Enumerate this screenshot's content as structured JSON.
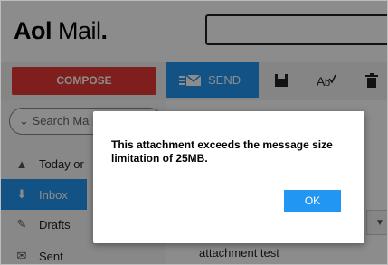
{
  "header": {
    "logo_aol": "Aol",
    "logo_mail": "Mail",
    "logo_dot": "."
  },
  "toolbar": {
    "compose_label": "COMPOSE",
    "send_label": "SEND",
    "icons": [
      "save-icon",
      "spellcheck-icon",
      "trash-icon"
    ]
  },
  "sidebar": {
    "search_placeholder": "Search Ma",
    "items": [
      {
        "label": "Today or",
        "icon": "aol-icon"
      },
      {
        "label": "Inbox",
        "icon": "inbox-icon",
        "active": true
      },
      {
        "label": "Drafts",
        "icon": "drafts-icon"
      },
      {
        "label": "Sent",
        "icon": "sent-icon"
      }
    ]
  },
  "message_list": {
    "visible_subject": "attachment test"
  },
  "dialog": {
    "message": "This attachment exceeds the message size limitation of 25MB.",
    "ok_label": "OK"
  },
  "colors": {
    "accent": "#2196f3",
    "compose": "#e53935"
  }
}
